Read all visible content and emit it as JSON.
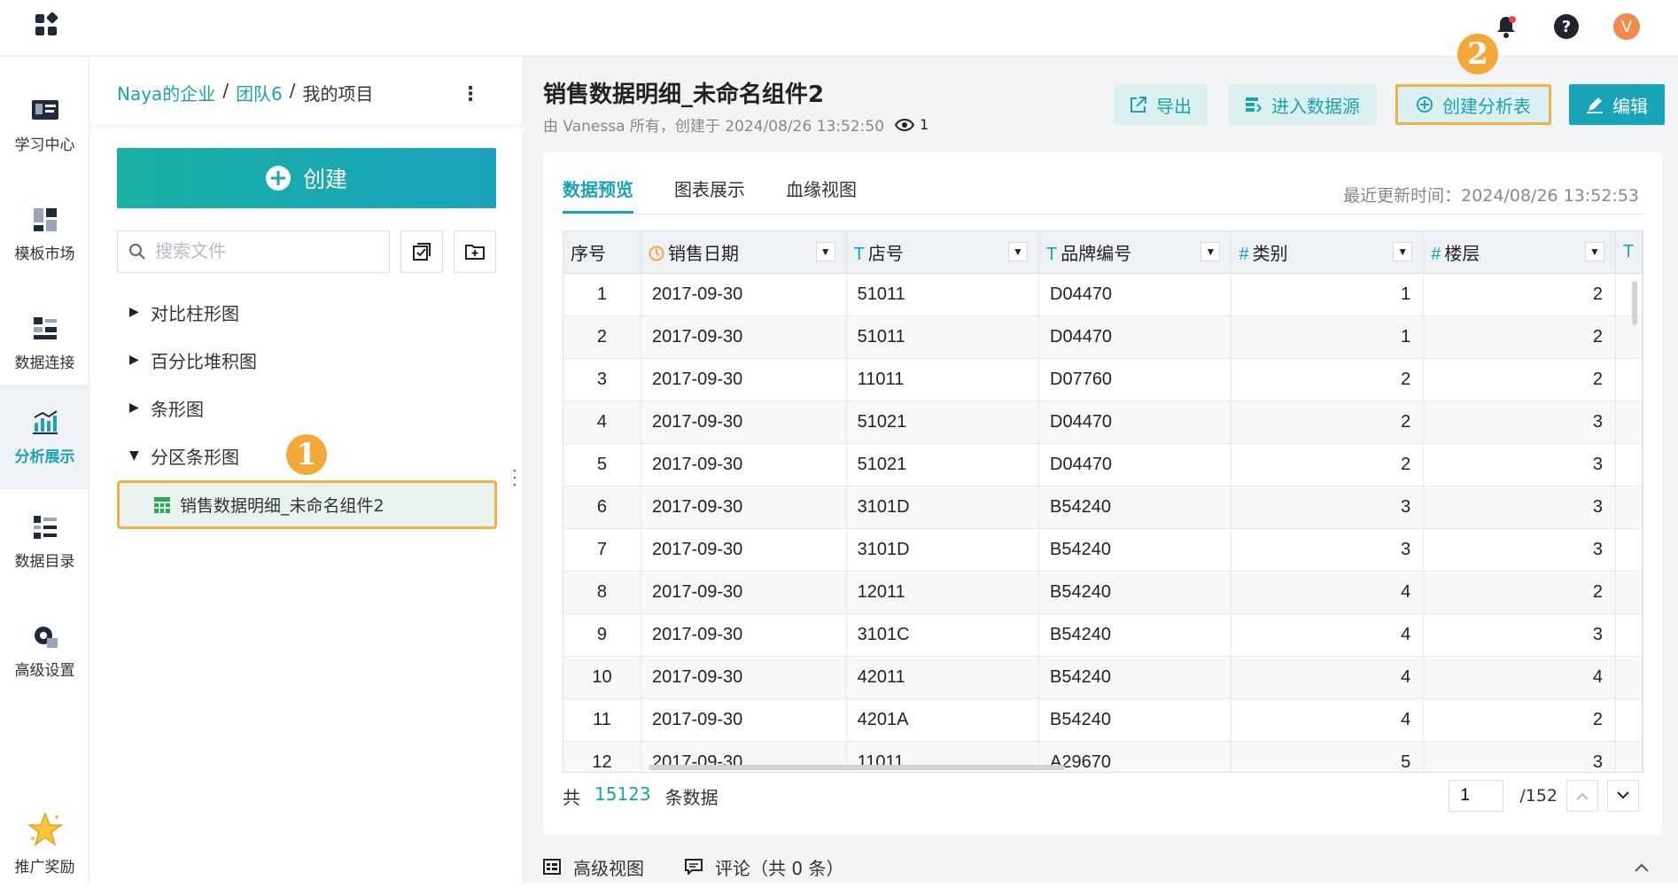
{
  "topbar": {
    "avatar_letter": "V",
    "help_label": "?"
  },
  "nav": {
    "items": [
      {
        "label": "学习中心",
        "icon": "learning-center-icon"
      },
      {
        "label": "模板市场",
        "icon": "template-market-icon"
      },
      {
        "label": "数据连接",
        "icon": "data-connection-icon"
      },
      {
        "label": "分析展示",
        "icon": "analysis-display-icon",
        "active": true
      },
      {
        "label": "数据目录",
        "icon": "data-catalog-icon"
      },
      {
        "label": "高级设置",
        "icon": "advanced-settings-icon"
      },
      {
        "label": "推广奖励",
        "icon": "promotion-reward-icon"
      }
    ]
  },
  "sidepanel": {
    "breadcrumb": [
      "Naya的企业",
      "团队6",
      "我的项目"
    ],
    "breadcrumb_sep": "/",
    "create_label": "创建",
    "search_placeholder": "搜索文件",
    "tree": [
      "对比柱形图",
      "百分比堆积图",
      "条形图",
      "分区条形图"
    ],
    "selected_item": "销售数据明细_未命名组件2",
    "badge_1": "1"
  },
  "header": {
    "title": "销售数据明细_未命名组件2",
    "meta": "由 Vanessa 所有，创建于 2024/08/26 13:52:50",
    "views": "1",
    "buttons": {
      "export": "导出",
      "enter_source": "进入数据源",
      "create_analysis": "创建分析表",
      "edit": "编辑"
    },
    "badge_2": "2"
  },
  "tabs": [
    "数据预览",
    "图表展示",
    "血缘视图"
  ],
  "updated": "最近更新时间：2024/08/26 13:52:53",
  "table": {
    "columns": [
      {
        "label": "序号",
        "type": ""
      },
      {
        "label": "销售日期",
        "type": "date"
      },
      {
        "label": "店号",
        "type": "T"
      },
      {
        "label": "品牌编号",
        "type": "T"
      },
      {
        "label": "类别",
        "type": "#"
      },
      {
        "label": "楼层",
        "type": "#"
      }
    ],
    "rows": [
      [
        "1",
        "2017-09-30",
        "51011",
        "D04470",
        "1",
        "2"
      ],
      [
        "2",
        "2017-09-30",
        "51011",
        "D04470",
        "1",
        "2"
      ],
      [
        "3",
        "2017-09-30",
        "11011",
        "D07760",
        "2",
        "2"
      ],
      [
        "4",
        "2017-09-30",
        "51021",
        "D04470",
        "2",
        "3"
      ],
      [
        "5",
        "2017-09-30",
        "51021",
        "D04470",
        "2",
        "3"
      ],
      [
        "6",
        "2017-09-30",
        "3101D",
        "B54240",
        "3",
        "3"
      ],
      [
        "7",
        "2017-09-30",
        "3101D",
        "B54240",
        "3",
        "3"
      ],
      [
        "8",
        "2017-09-30",
        "12011",
        "B54240",
        "4",
        "2"
      ],
      [
        "9",
        "2017-09-30",
        "3101C",
        "B54240",
        "4",
        "3"
      ],
      [
        "10",
        "2017-09-30",
        "42011",
        "B54240",
        "4",
        "4"
      ],
      [
        "11",
        "2017-09-30",
        "4201A",
        "B54240",
        "4",
        "2"
      ],
      [
        "12",
        "2017-09-30",
        "11011",
        "A29670",
        "5",
        "3"
      ]
    ]
  },
  "footer": {
    "prefix": "共",
    "count": "15123",
    "suffix": "条数据",
    "page": "1",
    "total_pages": "/152"
  },
  "bottom": {
    "advanced_view": "高级视图",
    "comments": "评论（共 0 条）"
  },
  "colors": {
    "accent": "#1aa3b3",
    "highlight": "#f0b04a",
    "badge": "#f3a839"
  }
}
